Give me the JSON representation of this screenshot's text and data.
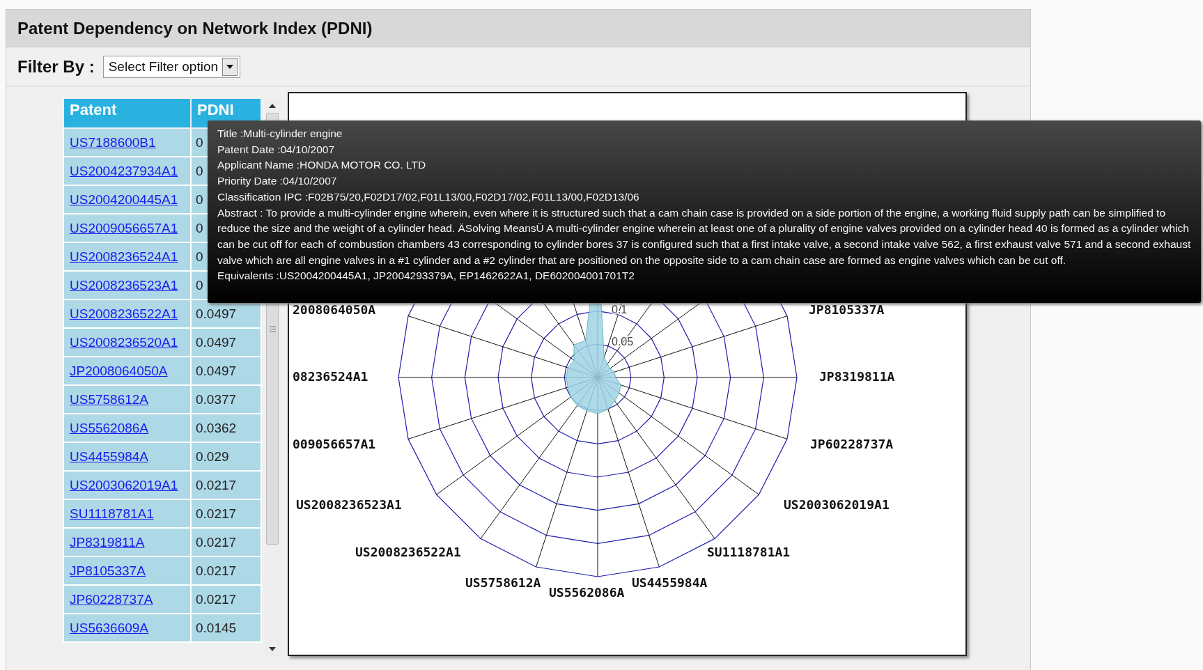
{
  "header": {
    "title": "Patent Dependency on Network Index (PDNI)"
  },
  "filter": {
    "label": "Filter By :",
    "value": "Select Filter option"
  },
  "table": {
    "columns": [
      "Patent",
      "PDNI"
    ],
    "rows": [
      {
        "patent": "US7188600B1",
        "pdni": "0"
      },
      {
        "patent": "US2004237934A1",
        "pdni": "0"
      },
      {
        "patent": "US2004200445A1",
        "pdni": "0"
      },
      {
        "patent": "US2009056657A1",
        "pdni": "0"
      },
      {
        "patent": "US2008236524A1",
        "pdni": "0"
      },
      {
        "patent": "US2008236523A1",
        "pdni": "0"
      },
      {
        "patent": "US2008236522A1",
        "pdni": "0.0497"
      },
      {
        "patent": "US2008236520A1",
        "pdni": "0.0497"
      },
      {
        "patent": "JP2008064050A",
        "pdni": "0.0497"
      },
      {
        "patent": "US5758612A",
        "pdni": "0.0377"
      },
      {
        "patent": "US5562086A",
        "pdni": "0.0362"
      },
      {
        "patent": "US4455984A",
        "pdni": "0.029"
      },
      {
        "patent": "US2003062019A1",
        "pdni": "0.0217"
      },
      {
        "patent": "SU1118781A1",
        "pdni": "0.0217"
      },
      {
        "patent": "JP8319811A",
        "pdni": "0.0217"
      },
      {
        "patent": "JP8105337A",
        "pdni": "0.0217"
      },
      {
        "patent": "JP60228737A",
        "pdni": "0.0217"
      },
      {
        "patent": "US5636609A",
        "pdni": "0.0145"
      }
    ]
  },
  "chart": {
    "axis_labels": [
      "2008064050A",
      "JP8105337A",
      "08236524A1",
      "JP8319811A",
      "009056657A1",
      "JP60228737A",
      "US2008236523A1",
      "US2003062019A1",
      "US2008236522A1",
      "SU1118781A1",
      "US5758612A",
      "US4455984A",
      "US5562086A"
    ],
    "tick_labels": [
      "0.1",
      "0.05"
    ]
  },
  "tooltip": {
    "lines": [
      "Title :Multi-cylinder engine",
      "Patent Date :04/10/2007",
      "Applicant Name :HONDA MOTOR CO. LTD",
      "Priority Date :04/10/2007",
      "Classification IPC :F02B75/20,F02D17/02,F01L13/00,F02D17/02,F01L13/00,F02D13/06"
    ],
    "abstract": "Abstract : To provide a multi-cylinder engine wherein, even where it is structured such that a cam chain case is provided on a side portion of the engine, a working fluid supply path can be simplified to reduce the size and the weight of a cylinder head. ÄSolving MeansÜ A multi-cylinder engine wherein at least one of a plurality of engine valves provided on a cylinder head 40 is formed as a cylinder which can be cut off for each of combustion chambers 43 corresponding to cylinder bores 37 is configured such that a first intake valve, a second intake valve 562, a first exhaust valve 571 and a second exhaust valve which are all engine valves in a #1 cylinder and a #2 cylinder that are positioned on the opposite side to a cam chain case are formed as engine valves which can be cut off.",
    "equivalents": "Equivalents :US2004200445A1, JP2004293379A, EP1462622A1, DE602004001701T2"
  }
}
